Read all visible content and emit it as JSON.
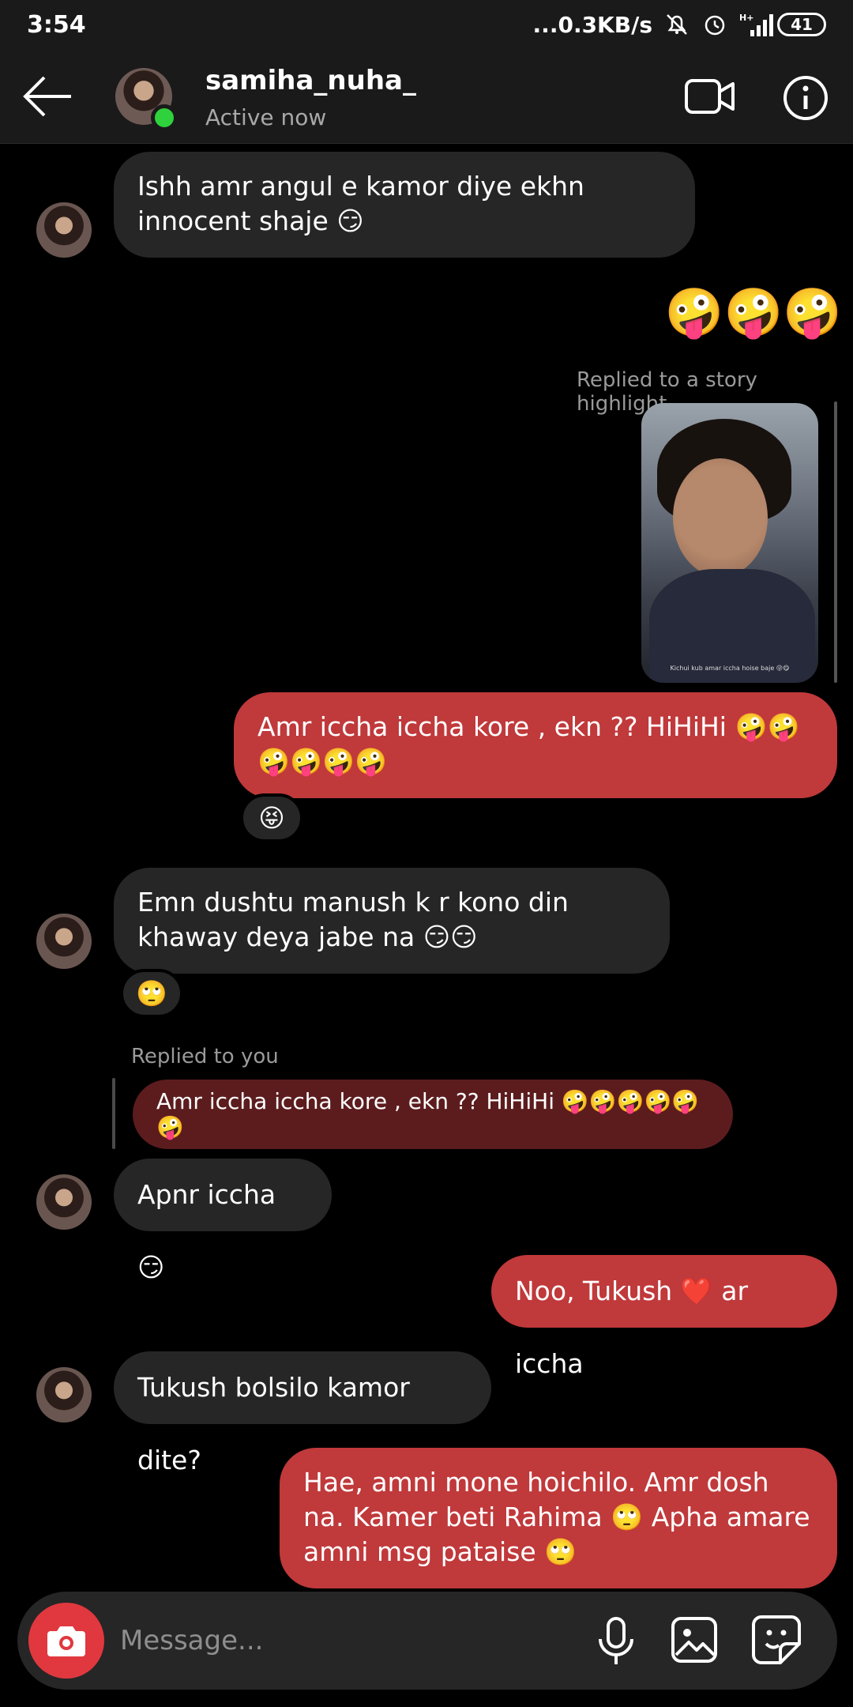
{
  "status_bar": {
    "time": "3:54",
    "network_speed": "...0.3KB/s",
    "signal_label": "H+",
    "battery": "41"
  },
  "header": {
    "username": "samiha_nuha_",
    "status": "Active now",
    "icons": [
      "back-arrow-icon",
      "video-call-icon",
      "info-icon"
    ]
  },
  "messages": [
    {
      "from": "them",
      "text": "Ishh amr angul e kamor diye ekhn innocent shaje 😏"
    },
    {
      "from": "me",
      "type": "emoji-only",
      "text": "🤪🤪🤪"
    },
    {
      "from": "me",
      "type": "story-reply",
      "label": "Replied to a story highlight",
      "story_caption": "Kichui kub amar iccha hoise baje 😜😋"
    },
    {
      "from": "me",
      "text": "Amr iccha iccha kore , ekn ?? HiHiHi 🤪🤪🤪🤪🤪🤪",
      "reaction": "😝"
    },
    {
      "from": "them",
      "text": "Emn dushtu manush k r kono din khaway deya jabe na 😏😏",
      "reaction": "🙄"
    },
    {
      "from": "them",
      "type": "reply",
      "reply_label": "Replied to you",
      "quoted_text": "Amr iccha iccha kore , ekn ?? HiHiHi 🤪🤪🤪🤪🤪🤪",
      "text": "Apnr iccha 😏"
    },
    {
      "from": "me",
      "text": "Noo, Tukush ❤️ ar iccha"
    },
    {
      "from": "them",
      "text": "Tukush bolsilo kamor dite?"
    },
    {
      "from": "me",
      "text": "Hae, amni mone hoichilo. Amr dosh na. Kamer beti Rahima 🙄 Apha amare amni msg pataise 🙄"
    }
  ],
  "composer": {
    "placeholder": "Message...",
    "icons": [
      "camera-icon",
      "microphone-icon",
      "gallery-icon",
      "sticker-icon"
    ]
  },
  "colors": {
    "outgoing_bubble": "#c0393b",
    "incoming_bubble": "#262626",
    "quoted_bubble": "#5c1c1e",
    "online_dot": "#2fd13c",
    "camera_button": "#e0383e"
  }
}
